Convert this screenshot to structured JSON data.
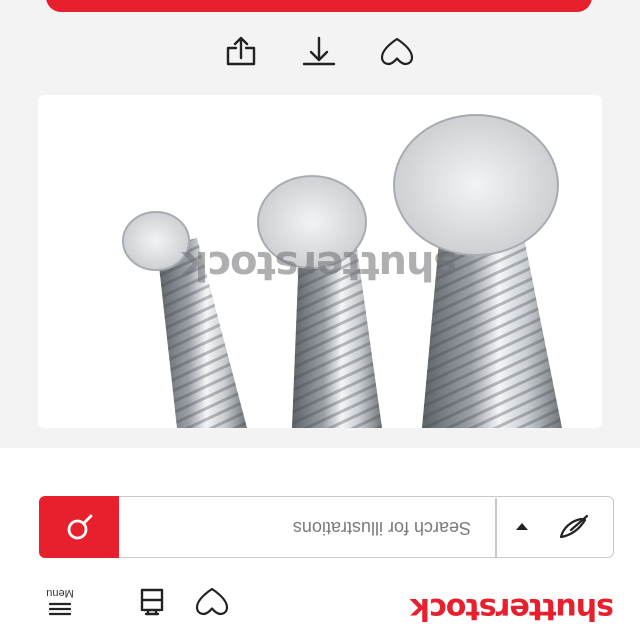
{
  "header": {
    "logo_text": "shutterstock",
    "menu_label": "Menu",
    "icons": [
      "heart-icon",
      "collection-icon",
      "menu-icon"
    ]
  },
  "search": {
    "placeholder": "Search for illustrations",
    "type_icon": "illustration-pen-icon",
    "button_icon": "search-icon"
  },
  "image": {
    "watermark": "shutterstock",
    "subject": "three steel rebar rods"
  },
  "actions": {
    "icons": [
      "save-heart-icon",
      "share-icon",
      "download-icon"
    ]
  },
  "colors": {
    "brand": "#e8202e",
    "background": "#f3f3f4",
    "border": "#c9c9c9"
  }
}
